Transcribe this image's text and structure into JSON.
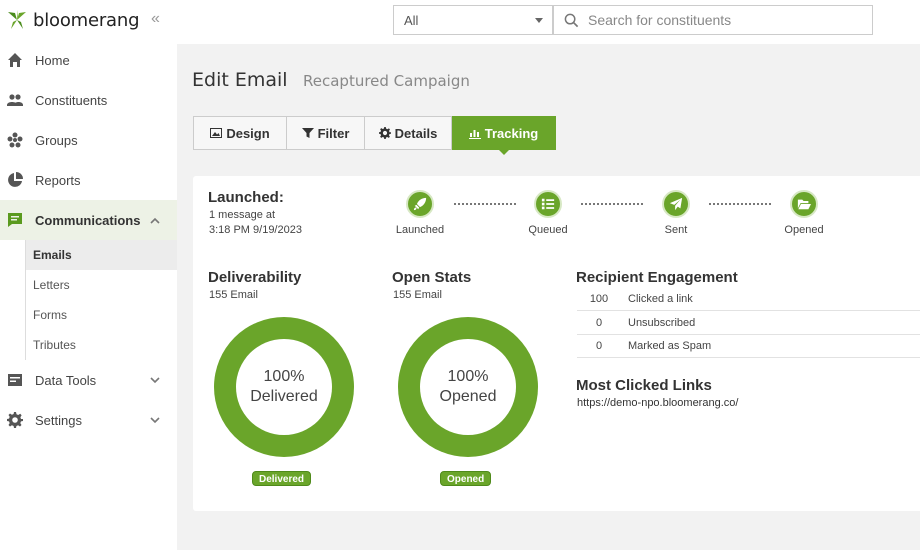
{
  "brand": {
    "name": "bloomerang",
    "accent": "#6aa52a"
  },
  "sidebar": {
    "collapse_glyph": "«",
    "items": [
      {
        "label": "Home",
        "icon": "home-icon"
      },
      {
        "label": "Constituents",
        "icon": "people-icon"
      },
      {
        "label": "Groups",
        "icon": "groups-icon"
      },
      {
        "label": "Reports",
        "icon": "pie-chart-icon"
      },
      {
        "label": "Communications",
        "icon": "message-icon",
        "active": true,
        "expanded": true
      },
      {
        "label": "Data Tools",
        "icon": "data-tools-icon"
      },
      {
        "label": "Settings",
        "icon": "gear-icon"
      }
    ],
    "communications_sub": [
      {
        "label": "Emails",
        "active": true
      },
      {
        "label": "Letters"
      },
      {
        "label": "Forms"
      },
      {
        "label": "Tributes"
      }
    ]
  },
  "topbar": {
    "filter_value": "All",
    "search_placeholder": "Search for constituents"
  },
  "header": {
    "title": "Edit Email",
    "subtitle": "Recaptured Campaign"
  },
  "tabs": [
    {
      "label": "Design",
      "icon": "image-icon"
    },
    {
      "label": "Filter",
      "icon": "funnel-icon"
    },
    {
      "label": "Details",
      "icon": "gear-icon"
    },
    {
      "label": "Tracking",
      "icon": "bar-chart-icon",
      "active": true
    }
  ],
  "launched": {
    "title": "Launched:",
    "line1": "1 message at",
    "line2": "3:18 PM 9/19/2023"
  },
  "steps": [
    {
      "label": "Launched",
      "icon": "rocket-icon"
    },
    {
      "label": "Queued",
      "icon": "list-icon"
    },
    {
      "label": "Sent",
      "icon": "paper-plane-icon"
    },
    {
      "label": "Opened",
      "icon": "folder-open-icon"
    }
  ],
  "deliverability": {
    "title": "Deliverability",
    "sub": "155 Email",
    "percent": "100%",
    "label": "Delivered",
    "badge": "Delivered"
  },
  "open_stats": {
    "title": "Open Stats",
    "sub": "155 Email",
    "percent": "100%",
    "label": "Opened",
    "badge": "Opened"
  },
  "engagement": {
    "title": "Recipient Engagement",
    "rows": [
      {
        "value": "100",
        "label": "Clicked a link"
      },
      {
        "value": "0",
        "label": "Unsubscribed"
      },
      {
        "value": "0",
        "label": "Marked as Spam"
      }
    ]
  },
  "links": {
    "title": "Most Clicked Links",
    "url": "https://demo-npo.bloomerang.co/"
  }
}
